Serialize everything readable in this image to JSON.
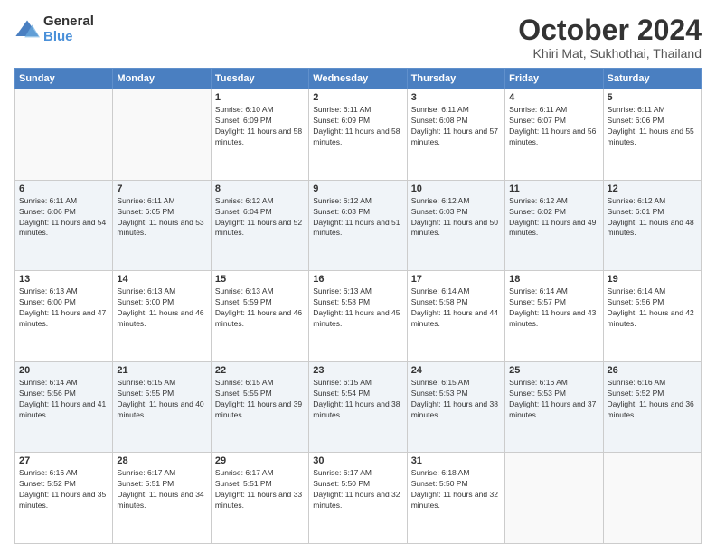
{
  "logo": {
    "general": "General",
    "blue": "Blue"
  },
  "title": "October 2024",
  "location": "Khiri Mat, Sukhothai, Thailand",
  "days_of_week": [
    "Sunday",
    "Monday",
    "Tuesday",
    "Wednesday",
    "Thursday",
    "Friday",
    "Saturday"
  ],
  "weeks": [
    [
      {
        "day": "",
        "content": ""
      },
      {
        "day": "",
        "content": ""
      },
      {
        "day": "1",
        "content": "Sunrise: 6:10 AM\nSunset: 6:09 PM\nDaylight: 11 hours and 58 minutes."
      },
      {
        "day": "2",
        "content": "Sunrise: 6:11 AM\nSunset: 6:09 PM\nDaylight: 11 hours and 58 minutes."
      },
      {
        "day": "3",
        "content": "Sunrise: 6:11 AM\nSunset: 6:08 PM\nDaylight: 11 hours and 57 minutes."
      },
      {
        "day": "4",
        "content": "Sunrise: 6:11 AM\nSunset: 6:07 PM\nDaylight: 11 hours and 56 minutes."
      },
      {
        "day": "5",
        "content": "Sunrise: 6:11 AM\nSunset: 6:06 PM\nDaylight: 11 hours and 55 minutes."
      }
    ],
    [
      {
        "day": "6",
        "content": "Sunrise: 6:11 AM\nSunset: 6:06 PM\nDaylight: 11 hours and 54 minutes."
      },
      {
        "day": "7",
        "content": "Sunrise: 6:11 AM\nSunset: 6:05 PM\nDaylight: 11 hours and 53 minutes."
      },
      {
        "day": "8",
        "content": "Sunrise: 6:12 AM\nSunset: 6:04 PM\nDaylight: 11 hours and 52 minutes."
      },
      {
        "day": "9",
        "content": "Sunrise: 6:12 AM\nSunset: 6:03 PM\nDaylight: 11 hours and 51 minutes."
      },
      {
        "day": "10",
        "content": "Sunrise: 6:12 AM\nSunset: 6:03 PM\nDaylight: 11 hours and 50 minutes."
      },
      {
        "day": "11",
        "content": "Sunrise: 6:12 AM\nSunset: 6:02 PM\nDaylight: 11 hours and 49 minutes."
      },
      {
        "day": "12",
        "content": "Sunrise: 6:12 AM\nSunset: 6:01 PM\nDaylight: 11 hours and 48 minutes."
      }
    ],
    [
      {
        "day": "13",
        "content": "Sunrise: 6:13 AM\nSunset: 6:00 PM\nDaylight: 11 hours and 47 minutes."
      },
      {
        "day": "14",
        "content": "Sunrise: 6:13 AM\nSunset: 6:00 PM\nDaylight: 11 hours and 46 minutes."
      },
      {
        "day": "15",
        "content": "Sunrise: 6:13 AM\nSunset: 5:59 PM\nDaylight: 11 hours and 46 minutes."
      },
      {
        "day": "16",
        "content": "Sunrise: 6:13 AM\nSunset: 5:58 PM\nDaylight: 11 hours and 45 minutes."
      },
      {
        "day": "17",
        "content": "Sunrise: 6:14 AM\nSunset: 5:58 PM\nDaylight: 11 hours and 44 minutes."
      },
      {
        "day": "18",
        "content": "Sunrise: 6:14 AM\nSunset: 5:57 PM\nDaylight: 11 hours and 43 minutes."
      },
      {
        "day": "19",
        "content": "Sunrise: 6:14 AM\nSunset: 5:56 PM\nDaylight: 11 hours and 42 minutes."
      }
    ],
    [
      {
        "day": "20",
        "content": "Sunrise: 6:14 AM\nSunset: 5:56 PM\nDaylight: 11 hours and 41 minutes."
      },
      {
        "day": "21",
        "content": "Sunrise: 6:15 AM\nSunset: 5:55 PM\nDaylight: 11 hours and 40 minutes."
      },
      {
        "day": "22",
        "content": "Sunrise: 6:15 AM\nSunset: 5:55 PM\nDaylight: 11 hours and 39 minutes."
      },
      {
        "day": "23",
        "content": "Sunrise: 6:15 AM\nSunset: 5:54 PM\nDaylight: 11 hours and 38 minutes."
      },
      {
        "day": "24",
        "content": "Sunrise: 6:15 AM\nSunset: 5:53 PM\nDaylight: 11 hours and 38 minutes."
      },
      {
        "day": "25",
        "content": "Sunrise: 6:16 AM\nSunset: 5:53 PM\nDaylight: 11 hours and 37 minutes."
      },
      {
        "day": "26",
        "content": "Sunrise: 6:16 AM\nSunset: 5:52 PM\nDaylight: 11 hours and 36 minutes."
      }
    ],
    [
      {
        "day": "27",
        "content": "Sunrise: 6:16 AM\nSunset: 5:52 PM\nDaylight: 11 hours and 35 minutes."
      },
      {
        "day": "28",
        "content": "Sunrise: 6:17 AM\nSunset: 5:51 PM\nDaylight: 11 hours and 34 minutes."
      },
      {
        "day": "29",
        "content": "Sunrise: 6:17 AM\nSunset: 5:51 PM\nDaylight: 11 hours and 33 minutes."
      },
      {
        "day": "30",
        "content": "Sunrise: 6:17 AM\nSunset: 5:50 PM\nDaylight: 11 hours and 32 minutes."
      },
      {
        "day": "31",
        "content": "Sunrise: 6:18 AM\nSunset: 5:50 PM\nDaylight: 11 hours and 32 minutes."
      },
      {
        "day": "",
        "content": ""
      },
      {
        "day": "",
        "content": ""
      }
    ]
  ]
}
